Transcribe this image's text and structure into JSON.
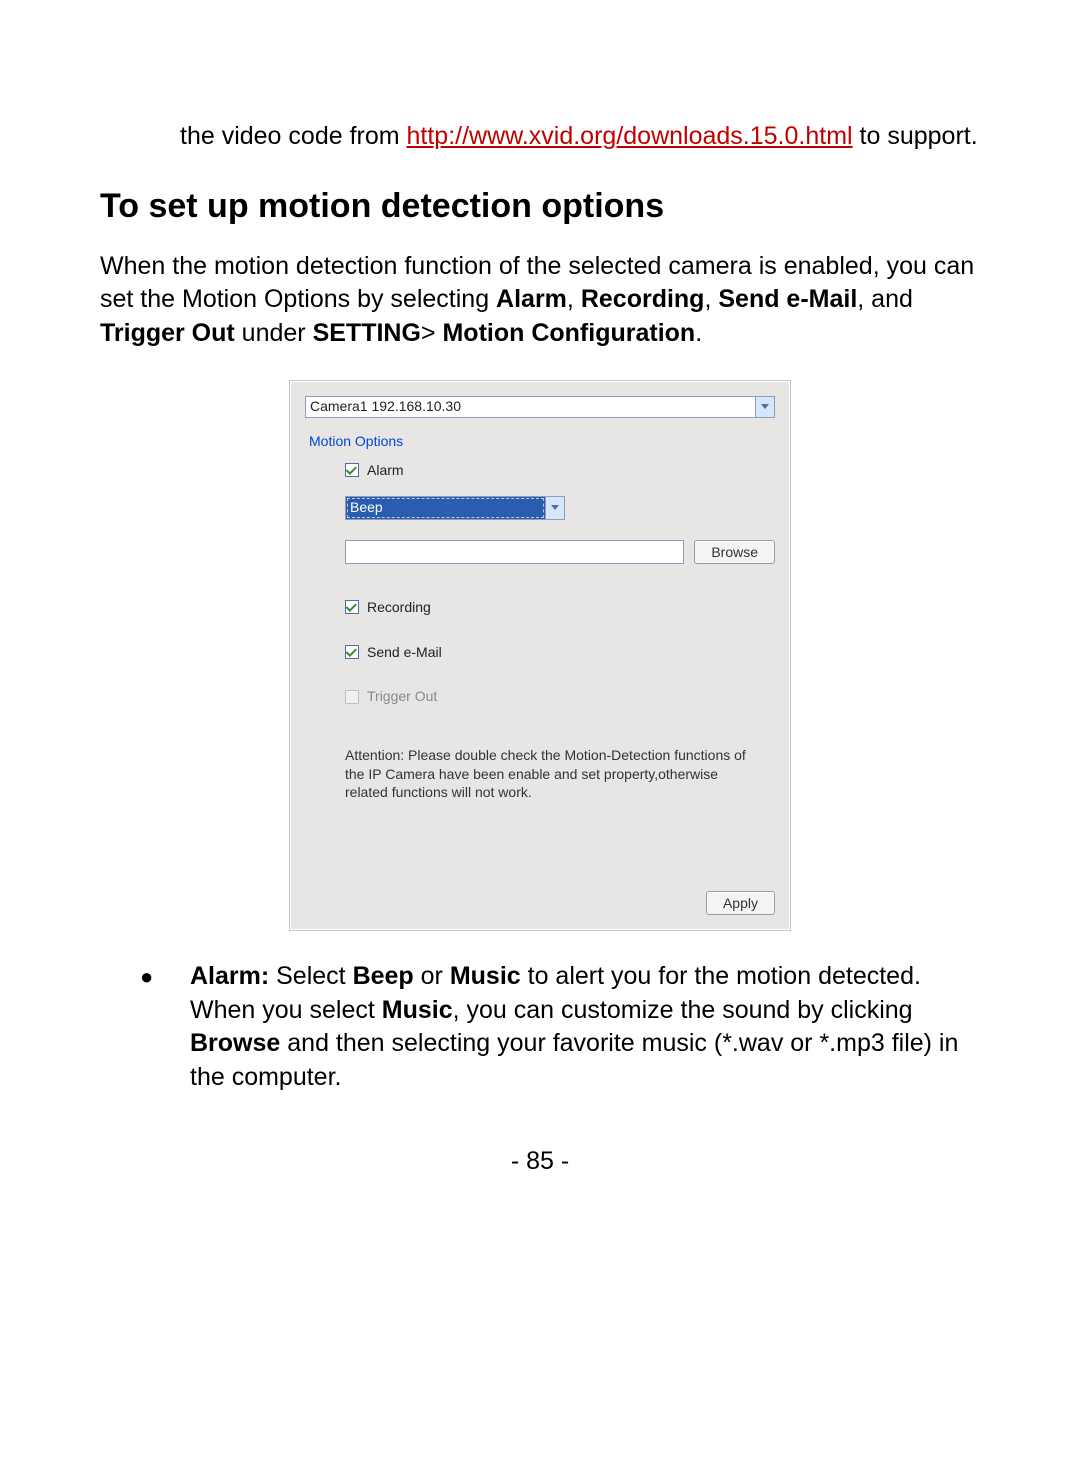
{
  "top": {
    "lead": "the video code from ",
    "link_text": "http://www.xvid.org/downloads.15.0.html",
    "trail": " to support."
  },
  "heading": "To set up motion detection options",
  "intro": {
    "t1": "When the motion detection function of the selected camera is enabled, you can set the Motion Options by selecting ",
    "b1": "Alarm",
    "c1": ", ",
    "b2": "Recording",
    "c2": ", ",
    "b3": "Send e-Mail",
    "c3": ", and ",
    "b4": "Trigger Out",
    "c4": " under ",
    "b5": "SETTING",
    "c5": "> ",
    "b6": "Motion Configuration",
    "c6": "."
  },
  "dialog": {
    "camera": "Camera1 192.168.10.30",
    "motion_options_label": "Motion Options",
    "alarm_label": "Alarm",
    "beep_value": "Beep",
    "browse_btn": "Browse",
    "recording_label": "Recording",
    "sendemail_label": "Send e-Mail",
    "trigger_label": "Trigger Out",
    "attention": "Attention: Please double check the Motion-Detection functions of the IP Camera have been enable and set property,otherwise related functions will not work.",
    "apply_btn": "Apply"
  },
  "bullet": {
    "b1": "Alarm:",
    "t1": "  Select ",
    "b2": "Beep",
    "t2": " or ",
    "b3": "Music",
    "t3": " to alert you for the motion detected.  When you select ",
    "b4": "Music",
    "t4": ", you can customize the sound by clicking ",
    "b5": "Browse",
    "t5": " and then selecting your favorite music (*.wav or *.mp3 file) in the computer."
  },
  "page_number": "- 85 -"
}
